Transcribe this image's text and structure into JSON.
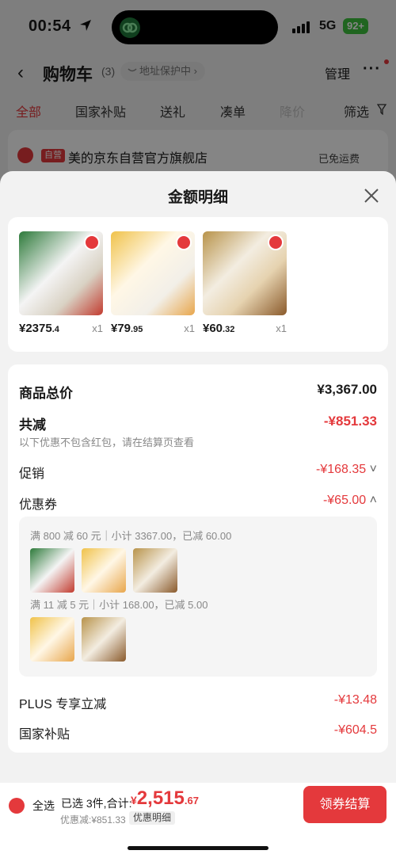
{
  "status_bar": {
    "time": "00:54",
    "network": "5G",
    "battery": "92+"
  },
  "nav": {
    "title": "购物车",
    "count": "(3)",
    "address_protect": "地址保护中",
    "manage": "管理"
  },
  "tabs": [
    {
      "label": "全部"
    },
    {
      "label": "国家补贴"
    },
    {
      "label": "送礼"
    },
    {
      "label": "凑单"
    },
    {
      "label": "降价"
    },
    {
      "label": "筛选"
    }
  ],
  "shop": {
    "tag": "自营",
    "name": "美的京东自营官方旗舰店",
    "shipping": "已免运费"
  },
  "sheet": {
    "title": "金额明细",
    "products": [
      {
        "price_int": "¥2375",
        "price_dec": ".4",
        "qty": "x1",
        "accent": "#2d7a3a"
      },
      {
        "price_int": "¥79",
        "price_dec": ".95",
        "qty": "x1",
        "accent": "#f0c24a"
      },
      {
        "price_int": "¥60",
        "price_dec": ".32",
        "qty": "x1",
        "accent": "#b8934a"
      }
    ],
    "total_label": "商品总价",
    "total_value": "¥3,367.00",
    "reduce_label": "共减",
    "reduce_value": "-¥851.33",
    "reduce_note": "以下优惠不包含红包，请在结算页查看",
    "promo_label": "促销",
    "promo_value": "-¥168.35",
    "coupon_label": "优惠券",
    "coupon_value": "-¥65.00",
    "coupon_lines": [
      "满 800 减 60 元｜小计 3367.00，已减 60.00",
      "满 11 减 5 元｜小计 168.00，已减 5.00"
    ],
    "plus_label": "PLUS 专享立减",
    "plus_value": "-¥13.48",
    "subsidy_label": "国家补贴",
    "subsidy_value": "-¥604.5"
  },
  "footer": {
    "select_all": "全选",
    "selected_text": "已选 3件,合计:",
    "total_symbol": "¥",
    "total_int": "2,515",
    "total_dec": ".67",
    "saved": "优惠减:¥851.33",
    "detail_tag": "优惠明细",
    "checkout": "领券结算"
  },
  "colors": {
    "accent": "#e4393c"
  }
}
